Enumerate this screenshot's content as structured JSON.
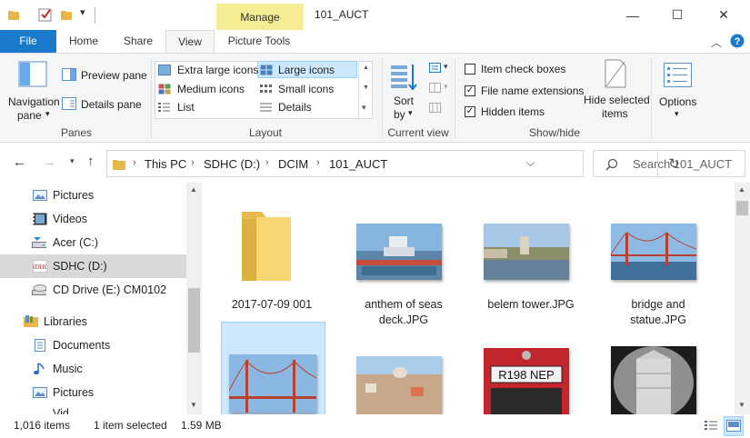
{
  "window": {
    "title": "101_AUCT",
    "manage_label": "Manage",
    "minimize_glyph": "—",
    "maximize_glyph": "☐",
    "close_glyph": "✕"
  },
  "tabs": [
    {
      "label": "File"
    },
    {
      "label": "Home"
    },
    {
      "label": "Share"
    },
    {
      "label": "View"
    },
    {
      "label": "Picture Tools"
    }
  ],
  "ribbon": {
    "panes": {
      "label": "Panes",
      "navigation_pane": "Navigation",
      "navigation_pane_2": "pane",
      "preview_pane": "Preview pane",
      "details_pane": "Details pane"
    },
    "layout": {
      "label": "Layout",
      "options": [
        "Extra large icons",
        "Large icons",
        "Medium icons",
        "Small icons",
        "List",
        "Details"
      ],
      "selected": "Large icons"
    },
    "current_view": {
      "label": "Current view",
      "sort_by": "Sort",
      "sort_by_2": "by"
    },
    "show_hide": {
      "label": "Show/hide",
      "item_check_boxes": "Item check boxes",
      "item_check_boxes_checked": false,
      "file_name_extensions": "File name extensions",
      "file_name_extensions_checked": true,
      "hidden_items": "Hidden items",
      "hidden_items_checked": true,
      "hide_selected": "Hide selected",
      "hide_selected_2": "items"
    },
    "options": {
      "label": "Options"
    },
    "check_glyph": "✓"
  },
  "address": {
    "breadcrumbs": [
      "This PC",
      "SDHC (D:)",
      "DCIM",
      "101_AUCT"
    ],
    "search_placeholder": "Search 101_AUCT"
  },
  "nav": {
    "items": [
      {
        "label": "Pictures",
        "icon": "pictures-icon"
      },
      {
        "label": "Videos",
        "icon": "videos-icon"
      },
      {
        "label": "Acer (C:)",
        "icon": "drive-c-icon"
      },
      {
        "label": "SDHC (D:)",
        "icon": "sd-card-icon",
        "selected": true
      },
      {
        "label": "CD Drive (E:) CM0102",
        "icon": "cd-drive-icon"
      },
      {
        "label": "Libraries",
        "icon": "libraries-icon"
      },
      {
        "label": "Documents",
        "icon": "documents-icon"
      },
      {
        "label": "Music",
        "icon": "music-icon"
      },
      {
        "label": "Pictures",
        "icon": "pictures-icon"
      }
    ]
  },
  "files": [
    {
      "name": "2017-07-09 001",
      "type": "folder"
    },
    {
      "name": "anthem of seas deck.JPG",
      "type": "image"
    },
    {
      "name": "belem tower.JPG",
      "type": "image"
    },
    {
      "name": "bridge and statue.JPG",
      "type": "image"
    }
  ],
  "status": {
    "count": "1,016 items",
    "selected": "1 item selected",
    "size": "1.59 MB"
  },
  "colors": {
    "accent": "#1979ca",
    "selection": "#cce8ff",
    "manage_tab": "#f6ec94"
  }
}
